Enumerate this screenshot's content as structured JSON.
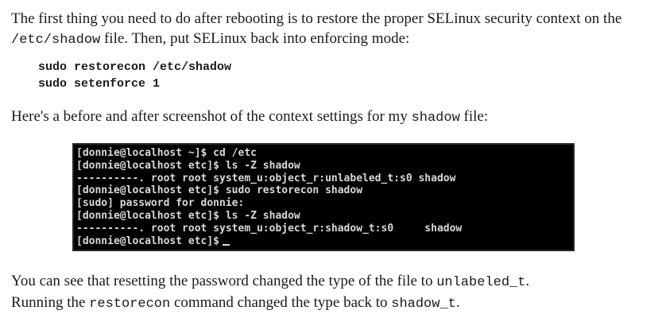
{
  "paragraph1": {
    "t1": "The first thing you need to do after rebooting is to restore the proper SELinux security context on the ",
    "c1": "/etc/shadow",
    "t2": " file. Then, put SELinux back into enforcing mode:"
  },
  "code_block": {
    "lines": [
      "sudo restorecon /etc/shadow",
      "sudo setenforce 1"
    ]
  },
  "paragraph2": {
    "t1": "Here's a before and after screenshot of the context settings for my ",
    "c1": "shadow",
    "t2": " file:"
  },
  "terminal": {
    "lines": [
      "[donnie@localhost ~]$ cd /etc",
      "[donnie@localhost etc]$ ls -Z shadow",
      "----------. root root system_u:object_r:unlabeled_t:s0 shadow",
      "[donnie@localhost etc]$ sudo restorecon shadow",
      "[sudo] password for donnie:",
      "[donnie@localhost etc]$ ls -Z shadow",
      "----------. root root system_u:object_r:shadow_t:s0     shadow",
      "[donnie@localhost etc]$"
    ]
  },
  "paragraph3": {
    "t1": "You can see that resetting the password changed the type of the file to ",
    "c1": "unlabeled_t",
    "t2": ".",
    "t3": "Running the ",
    "c2": "restorecon",
    "t4": " command changed the type back to ",
    "c3": "shadow_t",
    "t5": "."
  }
}
